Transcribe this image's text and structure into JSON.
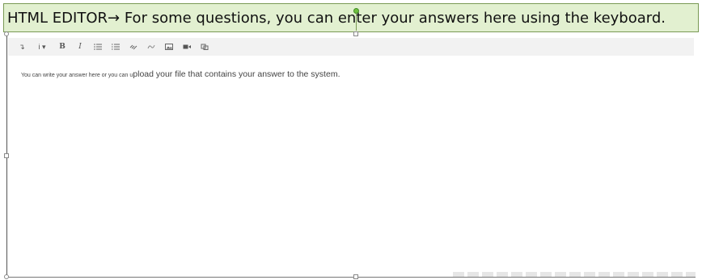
{
  "callout": {
    "text_before": "HTML EDITOR",
    "arrow": "→",
    "text_after": " For some questions, you can enter your answers here using the keyboard."
  },
  "toolbar": {
    "buttons": [
      {
        "icon": "paragraph-icon",
        "label": "↴"
      },
      {
        "icon": "info-icon",
        "label": "i ▾"
      },
      {
        "icon": "bold-icon",
        "label": "B"
      },
      {
        "icon": "italic-icon",
        "label": "I"
      },
      {
        "icon": "bullet-list-icon"
      },
      {
        "icon": "numbered-list-icon"
      },
      {
        "icon": "link-icon"
      },
      {
        "icon": "unlink-icon"
      },
      {
        "icon": "image-icon"
      },
      {
        "icon": "video-icon"
      },
      {
        "icon": "media-icon"
      }
    ]
  },
  "editor": {
    "text_small": "You can write your answer here or you can u",
    "text_large": "pload your file that contains  your answer to the system."
  },
  "colors": {
    "callout_bg": "#e2f0d0",
    "callout_border": "#7a9a55",
    "toolbar_bg": "#f2f2f2"
  }
}
